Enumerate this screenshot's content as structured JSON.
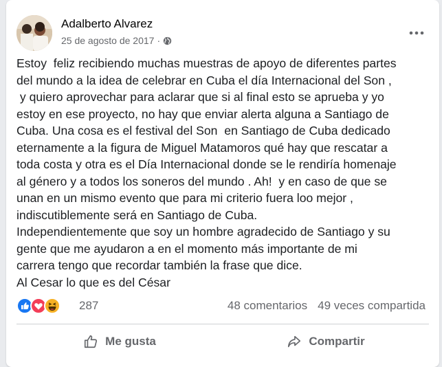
{
  "post": {
    "author": "Adalberto Alvarez",
    "date": "25 de agosto de 2017",
    "privacy_icon": "globe-icon",
    "more_icon": "more-dots-icon",
    "text": "Estoy  feliz recibiendo muchas muestras de apoyo de diferentes partes\ndel mundo a la idea de celebrar en Cuba el día Internacional del Son ,\n y quiero aprovechar para aclarar que si al final esto se aprueba y yo\nestoy en ese proyecto, no hay que enviar alerta alguna a Santiago de\nCuba. Una cosa es el festival del Son  en Santiago de Cuba dedicado\neternamente a la figura de Miguel Matamoros qué hay que rescatar a\ntoda costa y otra es el Día Internacional donde se le rendiría homenaje\nal género y a todos los soneros del mundo . Ah!  y en caso de que se\nunan en un mismo evento que para mi criterio fuera loo mejor ,\nindiscutiblemente será en Santiago de Cuba.\nIndependientemente que soy un hombre agradecido de Santiago y su\ngente que me ayudaron a en el momento más importante de mi\ncarrera tengo que recordar también la frase que dice.\nAl Cesar lo que es del César"
  },
  "reactions": {
    "icons": [
      "like-icon",
      "love-icon",
      "haha-icon"
    ],
    "count": "287",
    "comments": "48 comentarios",
    "shares": "49 veces compartida"
  },
  "actions": {
    "like_label": "Me gusta",
    "share_label": "Compartir"
  },
  "colors": {
    "like_blue": "#1877f2",
    "love_red": "#f33e58",
    "haha_yellow": "#f7b125",
    "secondary_text": "#65676b"
  }
}
